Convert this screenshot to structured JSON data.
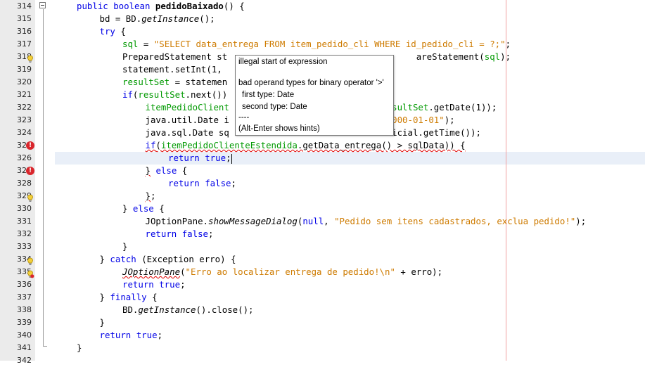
{
  "editor": {
    "lines": [
      {
        "num": "314",
        "html": "<span class=\"kw\">public boolean</span> <span class=\"bold\">pedidoBaixado</span>() {",
        "indent": 0,
        "icon": "",
        "fold": true
      },
      {
        "num": "315",
        "html": "bd = BD.<span class=\"meth\">getInstance</span>();",
        "indent": 1,
        "icon": ""
      },
      {
        "num": "316",
        "html": "<span class=\"kw\">try</span> {",
        "indent": 1,
        "icon": ""
      },
      {
        "num": "317",
        "html": "<span class=\"field\">sql</span> = <span class=\"str\">\"SELECT data_entrega FROM item_pedido_cli WHERE id_pedido_cli = ?;\"</span>;",
        "indent": 2,
        "icon": ""
      },
      {
        "num": "318",
        "html": "PreparedStatement st                                    areStatement(<span class=\"field\">sql</span>);",
        "indent": 2,
        "icon": "bulb"
      },
      {
        "num": "319",
        "html": "statement.setInt(1,",
        "indent": 2,
        "icon": ""
      },
      {
        "num": "320",
        "html": "<span class=\"field\">resultSet</span> = statemen",
        "indent": 2,
        "icon": ""
      },
      {
        "num": "321",
        "html": "<span class=\"kw\">if</span>(<span class=\"field\">resultSet</span>.next())",
        "indent": 2,
        "icon": ""
      },
      {
        "num": "322",
        "html": "<span class=\"field\">itemPedidoClient</span>                              <span class=\"field\">esultSet</span>.getDate(1));",
        "indent": 3,
        "icon": ""
      },
      {
        "num": "323",
        "html": "java.util.Date i                              <span class=\"str\">2000-01-01\"</span>);",
        "indent": 3,
        "icon": ""
      },
      {
        "num": "324",
        "html": "java.sql.Date sq                              nicial.getTime());",
        "indent": 3,
        "icon": ""
      },
      {
        "num": "325",
        "html": "<span class=\"err\"><span class=\"kw\">if</span>(<span class=\"field\">itemPedidoClienteEstendida</span>.getData_entrega() &gt; sqlData)) {</span>",
        "indent": 3,
        "icon": "error"
      },
      {
        "num": "326",
        "html": "<span class=\"kw\">return true</span>;<span class=\"caret\"></span>",
        "indent": 4,
        "icon": ""
      },
      {
        "num": "327",
        "html": "<span class=\"err\">}</span> <span class=\"kw\">else</span> {",
        "indent": 3,
        "icon": "error"
      },
      {
        "num": "328",
        "html": "<span class=\"kw\">return false</span>;",
        "indent": 4,
        "icon": ""
      },
      {
        "num": "329",
        "html": "<span class=\"err\">}</span>;",
        "indent": 3,
        "icon": "bulb"
      },
      {
        "num": "330",
        "html": "} <span class=\"kw\">else</span> {",
        "indent": 2,
        "icon": ""
      },
      {
        "num": "331",
        "html": "JOptionPane.<span class=\"meth\">showMessageDialog</span>(<span class=\"kw\">null</span>, <span class=\"str\">\"Pedido sem itens cadastrados, exclua pedido!\"</span>);",
        "indent": 3,
        "icon": ""
      },
      {
        "num": "332",
        "html": "<span class=\"kw\">return false</span>;",
        "indent": 3,
        "icon": ""
      },
      {
        "num": "333",
        "html": "}",
        "indent": 2,
        "icon": ""
      },
      {
        "num": "334",
        "html": "} <span class=\"kw\">catch</span> (Exception erro) {",
        "indent": 1,
        "icon": "bulb"
      },
      {
        "num": "335",
        "html": "<span class=\"err\"><span class=\"meth\">JOptionPane</span></span>(<span class=\"str\">\"Erro ao localizar entrega de pedido!\\n\"</span> + erro);",
        "indent": 2,
        "icon": "bulberr"
      },
      {
        "num": "336",
        "html": "<span class=\"kw\">return true</span>;",
        "indent": 2,
        "icon": ""
      },
      {
        "num": "337",
        "html": "} <span class=\"kw\">finally</span> {",
        "indent": 1,
        "icon": ""
      },
      {
        "num": "338",
        "html": "BD.<span class=\"meth\">getInstance</span>().close();",
        "indent": 2,
        "icon": ""
      },
      {
        "num": "339",
        "html": "}",
        "indent": 1,
        "icon": ""
      },
      {
        "num": "340",
        "html": "<span class=\"kw\">return true</span>;",
        "indent": 1,
        "icon": ""
      },
      {
        "num": "341",
        "html": "}",
        "indent": 0,
        "icon": ""
      },
      {
        "num": "342",
        "html": "",
        "indent": 0,
        "icon": ""
      }
    ]
  },
  "tooltip": {
    "title": "illegal start of expression",
    "line2": "bad operand types for binary operator '>'",
    "line3": "first type:  Date",
    "line4": "second type: Date",
    "line5": "----",
    "line6": "(Alt-Enter shows hints)"
  },
  "colors": {
    "keyword": "#0000e6",
    "string": "#ce7b00",
    "field": "#009900",
    "error": "#d9262c"
  },
  "icons": {
    "error": "error-icon",
    "bulb": "hint-bulb-icon",
    "bulberr": "hint-bulb-error-icon"
  }
}
